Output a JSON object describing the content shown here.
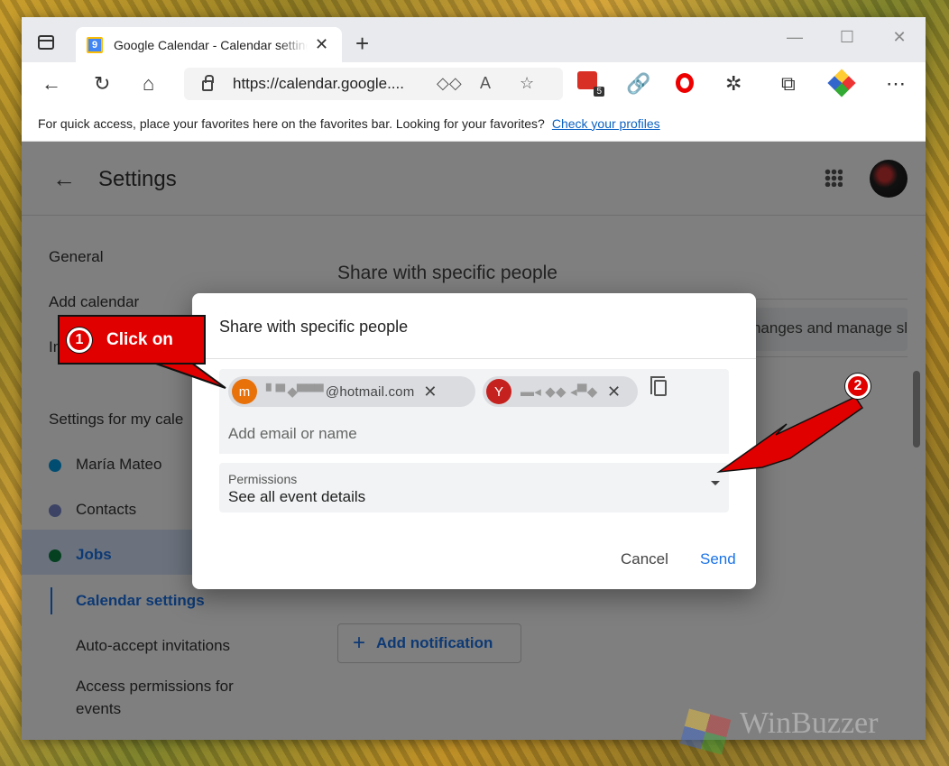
{
  "browser": {
    "tab_title": "Google Calendar - Calendar settings",
    "favicon_text": "9",
    "url": "https://calendar.google....",
    "ext_badge_count": "5",
    "favorites_text": "For quick access, place your favorites here on the favorites bar. Looking for your favorites?",
    "favorites_link": "Check your profiles"
  },
  "page": {
    "title": "Settings",
    "sidebar": {
      "general": "General",
      "add_calendar": "Add calendar",
      "import_partial": "Im",
      "settings_for_my": "Settings for my cale",
      "calendars": [
        {
          "label": "María Mateo",
          "color": "#039be5"
        },
        {
          "label": "Contacts",
          "color": "#7986cb"
        },
        {
          "label": "Jobs",
          "color": "#0b8043"
        }
      ],
      "calendar_settings": "Calendar settings",
      "auto_accept": "Auto-accept invitations",
      "access_perm_1": "Access permissions for",
      "access_perm_2": "events"
    },
    "main": {
      "heading": "Share with specific people",
      "field_partial": "nanges and manage sl",
      "add_notification": "Add notification"
    }
  },
  "dialog": {
    "title": "Share with specific people",
    "chips": [
      {
        "initial": "m",
        "text": "@hotmail.com",
        "color": "#e8710a"
      },
      {
        "initial": "Y",
        "text": "",
        "color": "#c5221f"
      }
    ],
    "add_email_placeholder": "Add email or name",
    "permissions_label": "Permissions",
    "permissions_value": "See all event details",
    "cancel": "Cancel",
    "send": "Send"
  },
  "annotations": {
    "callout1_number": "1",
    "callout1_text": "Click on",
    "callout2_number": "2",
    "accent_color": "#e00000"
  },
  "watermark": "WinBuzzer"
}
